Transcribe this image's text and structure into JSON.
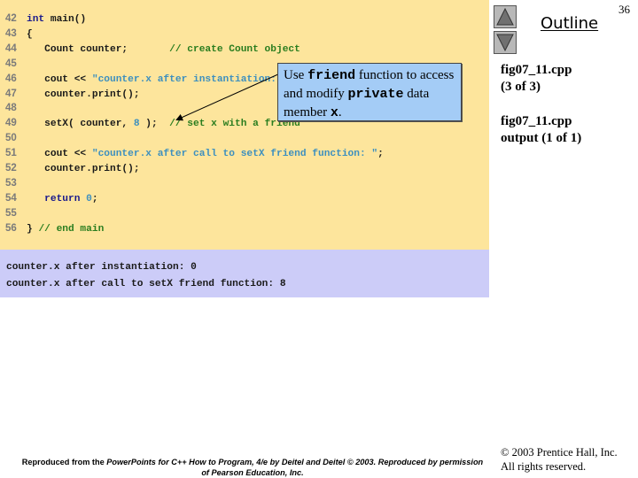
{
  "slide_number": "36",
  "navigation": {
    "outline_label": "Outline",
    "up_button_icon": "triangle-up-icon",
    "down_button_icon": "triangle-down-icon"
  },
  "side_panel": {
    "file1_name": "fig07_11.cpp",
    "file1_part": "(3 of 3)",
    "file2_name": "fig07_11.cpp",
    "file2_part": "output (1 of 1)"
  },
  "code": {
    "lines": [
      {
        "num": "42",
        "tokens": [
          {
            "t": "int",
            "c": "kw"
          },
          {
            "t": " main()",
            "c": ""
          }
        ]
      },
      {
        "num": "43",
        "tokens": [
          {
            "t": "{",
            "c": ""
          }
        ]
      },
      {
        "num": "44",
        "tokens": [
          {
            "t": "   Count counter;       ",
            "c": ""
          },
          {
            "t": "// create Count object",
            "c": "cmt"
          }
        ]
      },
      {
        "num": "45",
        "tokens": []
      },
      {
        "num": "46",
        "tokens": [
          {
            "t": "   cout << ",
            "c": ""
          },
          {
            "t": "\"counter.x after instantiation: \"",
            "c": "str"
          },
          {
            "t": ";",
            "c": ""
          }
        ]
      },
      {
        "num": "47",
        "tokens": [
          {
            "t": "   counter.print();",
            "c": ""
          }
        ]
      },
      {
        "num": "48",
        "tokens": []
      },
      {
        "num": "49",
        "tokens": [
          {
            "t": "   setX( counter, ",
            "c": ""
          },
          {
            "t": "8",
            "c": "num"
          },
          {
            "t": " );  ",
            "c": ""
          },
          {
            "t": "// set x with a friend",
            "c": "cmt"
          }
        ]
      },
      {
        "num": "50",
        "tokens": []
      },
      {
        "num": "51",
        "tokens": [
          {
            "t": "   cout << ",
            "c": ""
          },
          {
            "t": "\"counter.x after call to setX friend function: \"",
            "c": "str"
          },
          {
            "t": ";",
            "c": ""
          }
        ]
      },
      {
        "num": "52",
        "tokens": [
          {
            "t": "   counter.print();",
            "c": ""
          }
        ]
      },
      {
        "num": "53",
        "tokens": []
      },
      {
        "num": "54",
        "tokens": [
          {
            "t": "   ",
            "c": ""
          },
          {
            "t": "return",
            "c": "kw"
          },
          {
            "t": " ",
            "c": ""
          },
          {
            "t": "0",
            "c": "num"
          },
          {
            "t": ";",
            "c": ""
          }
        ]
      },
      {
        "num": "55",
        "tokens": []
      },
      {
        "num": "56",
        "tokens": [
          {
            "t": "} ",
            "c": ""
          },
          {
            "t": "// end main",
            "c": "cmt"
          }
        ]
      }
    ]
  },
  "output": {
    "lines": [
      "counter.x after instantiation: 0",
      "counter.x after call to setX friend function: 8"
    ]
  },
  "callout": {
    "part1": "Use ",
    "code1": "friend",
    "part2": " function to access and modify ",
    "code2": "private",
    "part3": " data member ",
    "code3": "x",
    "part4": "."
  },
  "copyright": {
    "line1": "© 2003 Prentice Hall, Inc.",
    "line2": "All rights reserved."
  },
  "footer": {
    "prefix": "Reproduced from the ",
    "italic": "PowerPoints for C++ How to Program, 4/e by Deitel and Deitel © 2003. Reproduced by permission of Pearson Education, Inc.",
    "suffix": ""
  },
  "colors": {
    "code_background": "#fde59c",
    "output_background": "#ccccf8",
    "callout_background": "#a4ccf6",
    "keyword": "#1a1a8c",
    "string": "#3c8fbf",
    "comment": "#2a7d1f"
  }
}
